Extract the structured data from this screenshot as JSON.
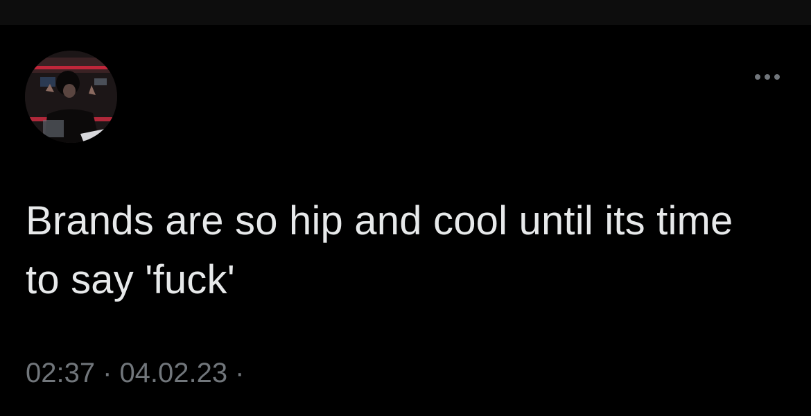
{
  "tweet": {
    "text": "Brands are so hip and cool until its time to say 'fuck'",
    "time": "02:37",
    "date": "04.02.23",
    "separator": "·"
  },
  "icons": {
    "more": "more-horizontal-icon"
  },
  "colors": {
    "background": "#000000",
    "text": "#e7e9ea",
    "muted": "#71767b"
  }
}
